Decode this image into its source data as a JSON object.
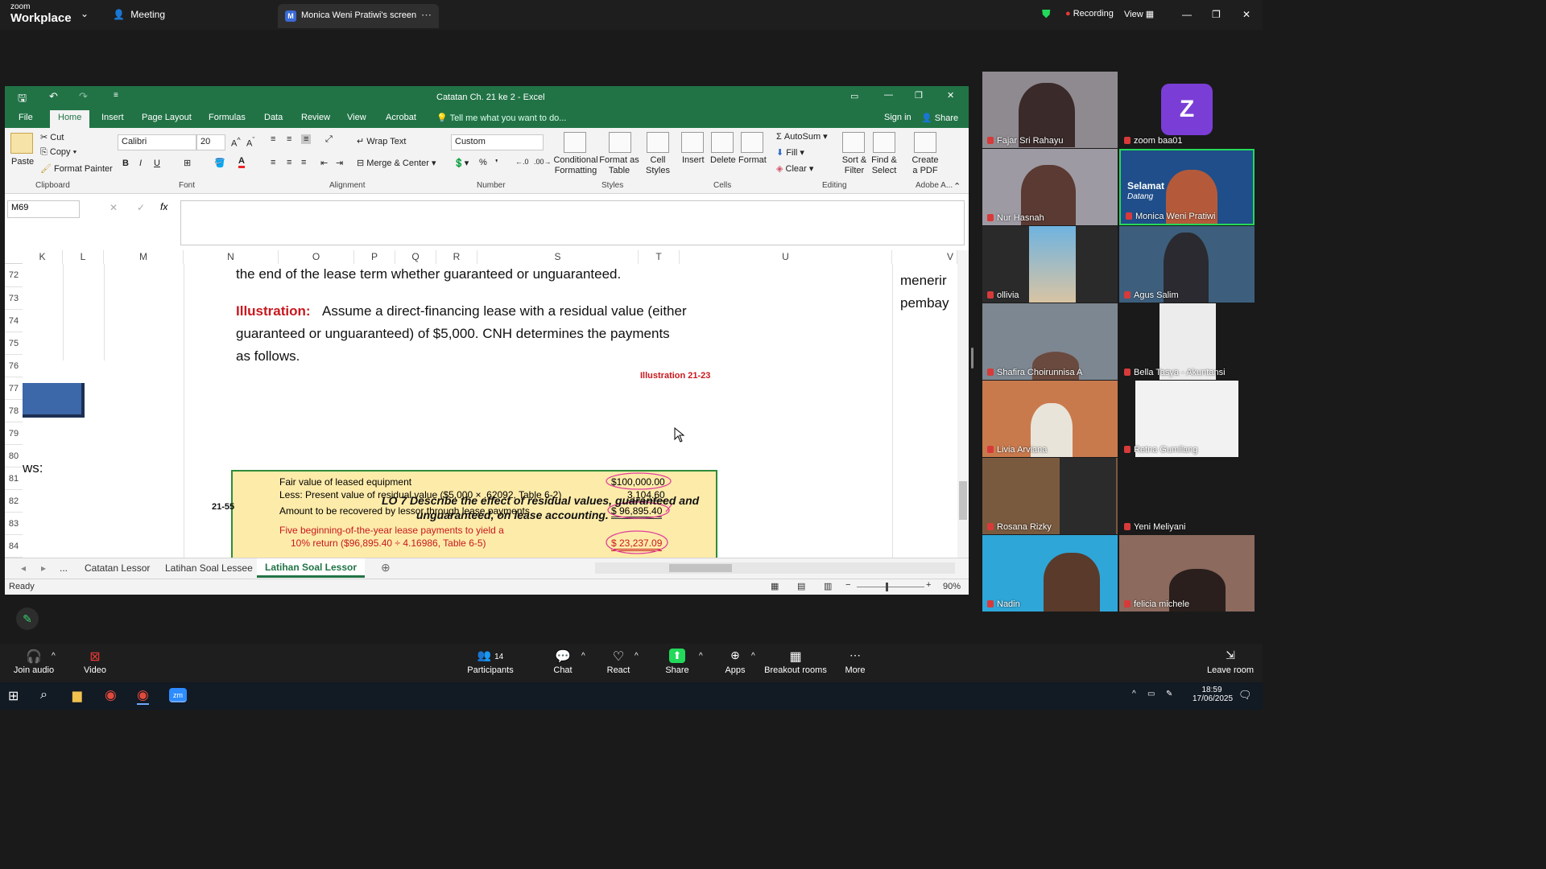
{
  "zoom": {
    "app_brand_top": "zoom",
    "app_brand": "Workplace",
    "meeting_label": "Meeting",
    "share_tab": "Monica Weni Pratiwi's screen",
    "share_tab_initial": "M",
    "recording": "Recording",
    "view": "View"
  },
  "excel": {
    "title": "Catatan Ch. 21 ke 2 - Excel",
    "tabs": [
      "File",
      "Home",
      "Insert",
      "Page Layout",
      "Formulas",
      "Data",
      "Review",
      "View",
      "Acrobat"
    ],
    "tell_me": "Tell me what you want to do...",
    "sign_in": "Sign in",
    "share": "Share",
    "ribbon": {
      "paste": "Paste",
      "cut": "Cut",
      "copy": "Copy",
      "format_painter": "Format Painter",
      "clipboard": "Clipboard",
      "font_name": "Calibri",
      "font_size": "20",
      "font": "Font",
      "wrap_text": "Wrap Text",
      "merge_center": "Merge & Center",
      "alignment": "Alignment",
      "number_format": "Custom",
      "number": "Number",
      "conditional_formatting": "Conditional Formatting",
      "format_as_table": "Format as Table",
      "cell_styles": "Cell Styles",
      "styles": "Styles",
      "insert": "Insert",
      "delete": "Delete",
      "format": "Format",
      "cells": "Cells",
      "autosum": "AutoSum",
      "fill": "Fill",
      "clear": "Clear",
      "sort_filter": "Sort & Filter",
      "find_select": "Find & Select",
      "editing": "Editing",
      "create_pdf": "Create a PDF",
      "adobe": "Adobe A..."
    },
    "name_box": "M69",
    "columns": [
      "K",
      "L",
      "M",
      "N",
      "O",
      "P",
      "Q",
      "R",
      "S",
      "T",
      "U",
      "V"
    ],
    "rows": [
      "72",
      "73",
      "74",
      "75",
      "76",
      "77",
      "78",
      "79",
      "80",
      "81",
      "82",
      "83",
      "84"
    ],
    "slide": {
      "line_top": "the end of the lease term whether guaranteed or unguaranteed.",
      "illustration_label": "Illustration:",
      "illustration_text_1": "Assume a direct-financing lease with a residual value (either",
      "illustration_text_2": "guaranteed or unguaranteed) of $5,000.  CNH determines the payments",
      "illustration_text_3": "as follows.",
      "illustration_num": "Illustration 21-23",
      "box_line1": "Fair value of leased equipment",
      "box_val1": "$100,000.00",
      "box_line2": "Less: Present value of residual value ($5,000 × .62092, Table 6-2)",
      "box_val2": "3,104.60",
      "box_line3": "Amount to be recovered by lessor through lease payments",
      "box_val3": "$  96,895.40",
      "box_line4a": "Five beginning-of-the-year lease payments to yield a",
      "box_line4b": "10% return ($96,895.40 ÷ 4.16986, Table 6-5)",
      "box_val4": "$  23,237.09",
      "page_num": "21-55",
      "lo_1": "LO 7  Describe the effect of residual values, guaranteed and",
      "lo_2": "unguaranteed, on lease accounting.",
      "right_text_1": "menerir",
      "right_text_2": "pembay",
      "left_text": "ws:"
    },
    "sheet_tabs": [
      "...",
      "Catatan Lessor",
      "Latihan Soal Lessee",
      "Latihan Soal Lessor"
    ],
    "status": "Ready",
    "zoom_level": "90%"
  },
  "participants": [
    {
      "name": "Fajar Sri Rahayu",
      "bg": "#8f8a90"
    },
    {
      "name": "zoom baa01",
      "bg": "#1a1a1a",
      "initial": "Z"
    },
    {
      "name": "Nur Hasnah",
      "bg": "#9d9aa3"
    },
    {
      "name": "Monica Weni Pratiwi",
      "bg": "#1f4e8a"
    },
    {
      "name": "ollivia",
      "bg": "#2a2a2a"
    },
    {
      "name": "Agus Salim",
      "bg": "#3d5f7d"
    },
    {
      "name": "Shafira Choirunnisa A",
      "bg": "#7d8791"
    },
    {
      "name": "Bella Tasya - Akuntansi",
      "bg": "#1a1a1a"
    },
    {
      "name": "Livia Arviana",
      "bg": "#c97a4d"
    },
    {
      "name": "Retna Gumilang",
      "bg": "#1a1a1a"
    },
    {
      "name": "Rosana Rizky",
      "bg": "#7a5a3e"
    },
    {
      "name": "Yeni Meliyani",
      "bg": "#1a1a1a"
    },
    {
      "name": "Nadin",
      "bg": "#2fa6d8"
    },
    {
      "name": "felicia michele",
      "bg": "#8c6a5e"
    }
  ],
  "speaker_banner": {
    "line1": "Selamat",
    "line2": "Datang"
  },
  "toolbar": {
    "join_audio": "Join audio",
    "video": "Video",
    "participants_count": "14",
    "participants": "Participants",
    "chat": "Chat",
    "react": "React",
    "share": "Share",
    "apps": "Apps",
    "breakout": "Breakout rooms",
    "more": "More",
    "leave": "Leave room"
  },
  "taskbar": {
    "time": "18:59",
    "date": "17/06/2025"
  },
  "colors": {
    "excel_green": "#217346",
    "zoom_bg": "#1a1a1a",
    "share_green": "#23d959"
  }
}
